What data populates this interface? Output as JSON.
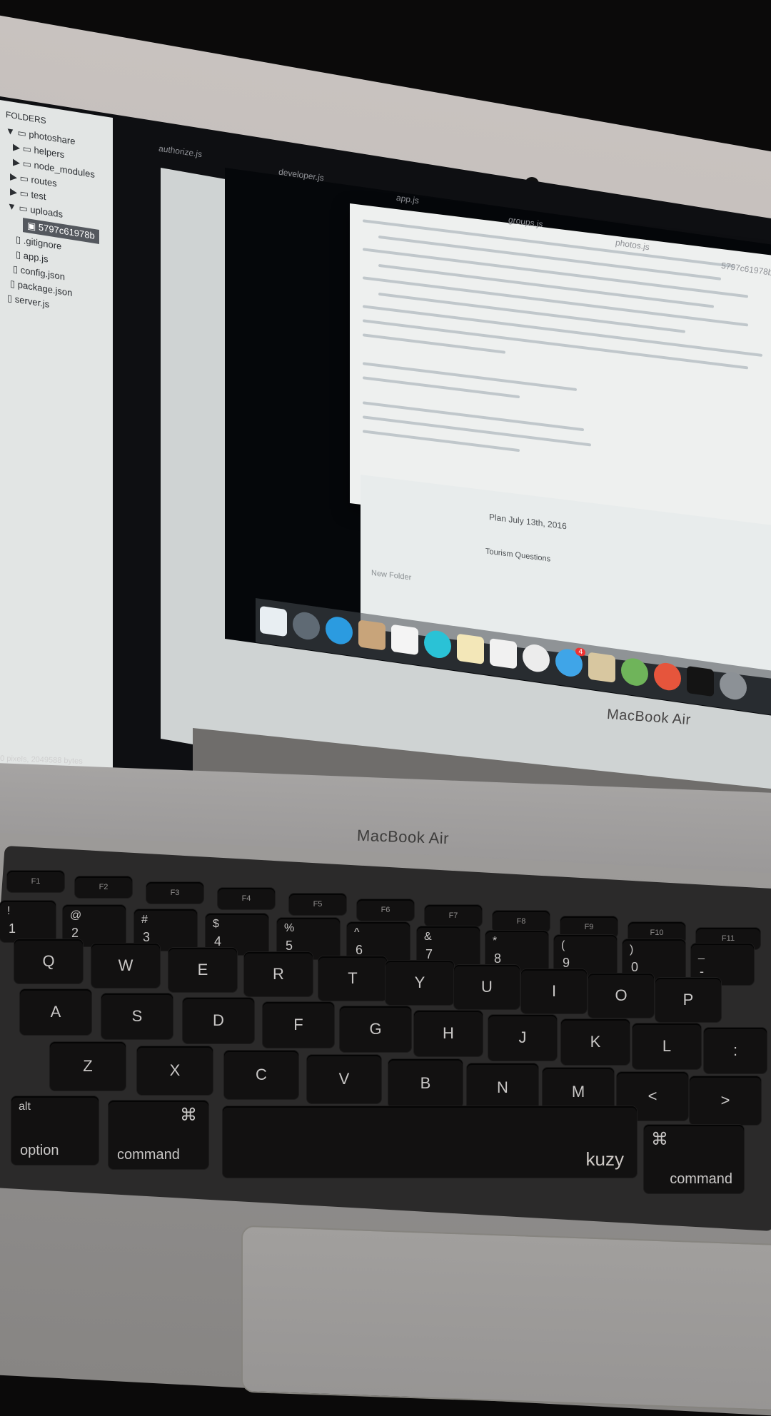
{
  "sidebar": {
    "title": "FOLDERS",
    "items": [
      {
        "label": "photoshare",
        "prefix": "▼",
        "icon": "folder-icon"
      },
      {
        "label": "helpers",
        "prefix": "▶",
        "icon": "folder-icon"
      },
      {
        "label": "node_modules",
        "prefix": "▶",
        "icon": "folder-icon"
      },
      {
        "label": "routes",
        "prefix": "▶",
        "icon": "folder-icon"
      },
      {
        "label": "test",
        "prefix": "▶",
        "icon": "folder-icon"
      },
      {
        "label": "uploads",
        "prefix": "▼",
        "icon": "folder-icon"
      },
      {
        "label": "5797c61978b",
        "prefix": "",
        "icon": "image-file-icon"
      },
      {
        "label": ".gitignore",
        "prefix": "",
        "icon": "file-icon"
      },
      {
        "label": "app.js",
        "prefix": "",
        "icon": "file-icon"
      },
      {
        "label": "config.json",
        "prefix": "",
        "icon": "file-icon"
      },
      {
        "label": "package.json",
        "prefix": "",
        "icon": "file-icon"
      },
      {
        "label": "server.js",
        "prefix": "",
        "icon": "file-icon"
      }
    ]
  },
  "tabs": [
    "authorize.js",
    "developer.js",
    "app.js",
    "groups.js",
    "photos.js",
    "5797c61978b"
  ],
  "status_bar": "0 pixels, 2049588 bytes",
  "notes": {
    "line1": "Plan July 13th, 2016",
    "line2": "Tourism Questions",
    "line3": "New Folder"
  },
  "dock": {
    "icons": [
      "finder-icon",
      "launchpad-icon",
      "safari-icon",
      "contacts-icon",
      "calendar-icon",
      "messages-icon",
      "notes-icon",
      "textedit-icon",
      "itunes-icon",
      "appstore-icon",
      "preview-icon",
      "android-studio-icon",
      "robot-icon",
      "terminal-icon",
      "system-preferences-icon"
    ],
    "badge": "4"
  },
  "brand": {
    "inner": "MacBook Air",
    "outer": "MacBook Air",
    "keyboard_cover": "kuzy"
  },
  "keys": {
    "fn_row": [
      "F1",
      "F2",
      "F3",
      "F4",
      "F5",
      "F6",
      "F7",
      "F8",
      "F9",
      "F10",
      "F11"
    ],
    "number_row": [
      {
        "top": "!",
        "bot": "1"
      },
      {
        "top": "@",
        "bot": "2"
      },
      {
        "top": "#",
        "bot": "3"
      },
      {
        "top": "$",
        "bot": "4"
      },
      {
        "top": "%",
        "bot": "5"
      },
      {
        "top": "^",
        "bot": "6"
      },
      {
        "top": "&",
        "bot": "7"
      },
      {
        "top": "*",
        "bot": "8"
      },
      {
        "top": "(",
        "bot": "9"
      },
      {
        "top": ")",
        "bot": "0"
      },
      {
        "top": "_",
        "bot": "-"
      },
      {
        "top": "+",
        "bot": "="
      }
    ],
    "q_row": [
      "Q",
      "W",
      "E",
      "R",
      "T",
      "Y",
      "U",
      "I",
      "O",
      "P",
      "{"
    ],
    "a_row": [
      "A",
      "S",
      "D",
      "F",
      "G",
      "H",
      "J",
      "K",
      "L",
      ":"
    ],
    "z_row": [
      "Z",
      "X",
      "C",
      "V",
      "B",
      "N",
      "M",
      "<",
      ">"
    ],
    "option_top": "alt",
    "option": "option",
    "command_symbol": "⌘",
    "command": "command"
  }
}
